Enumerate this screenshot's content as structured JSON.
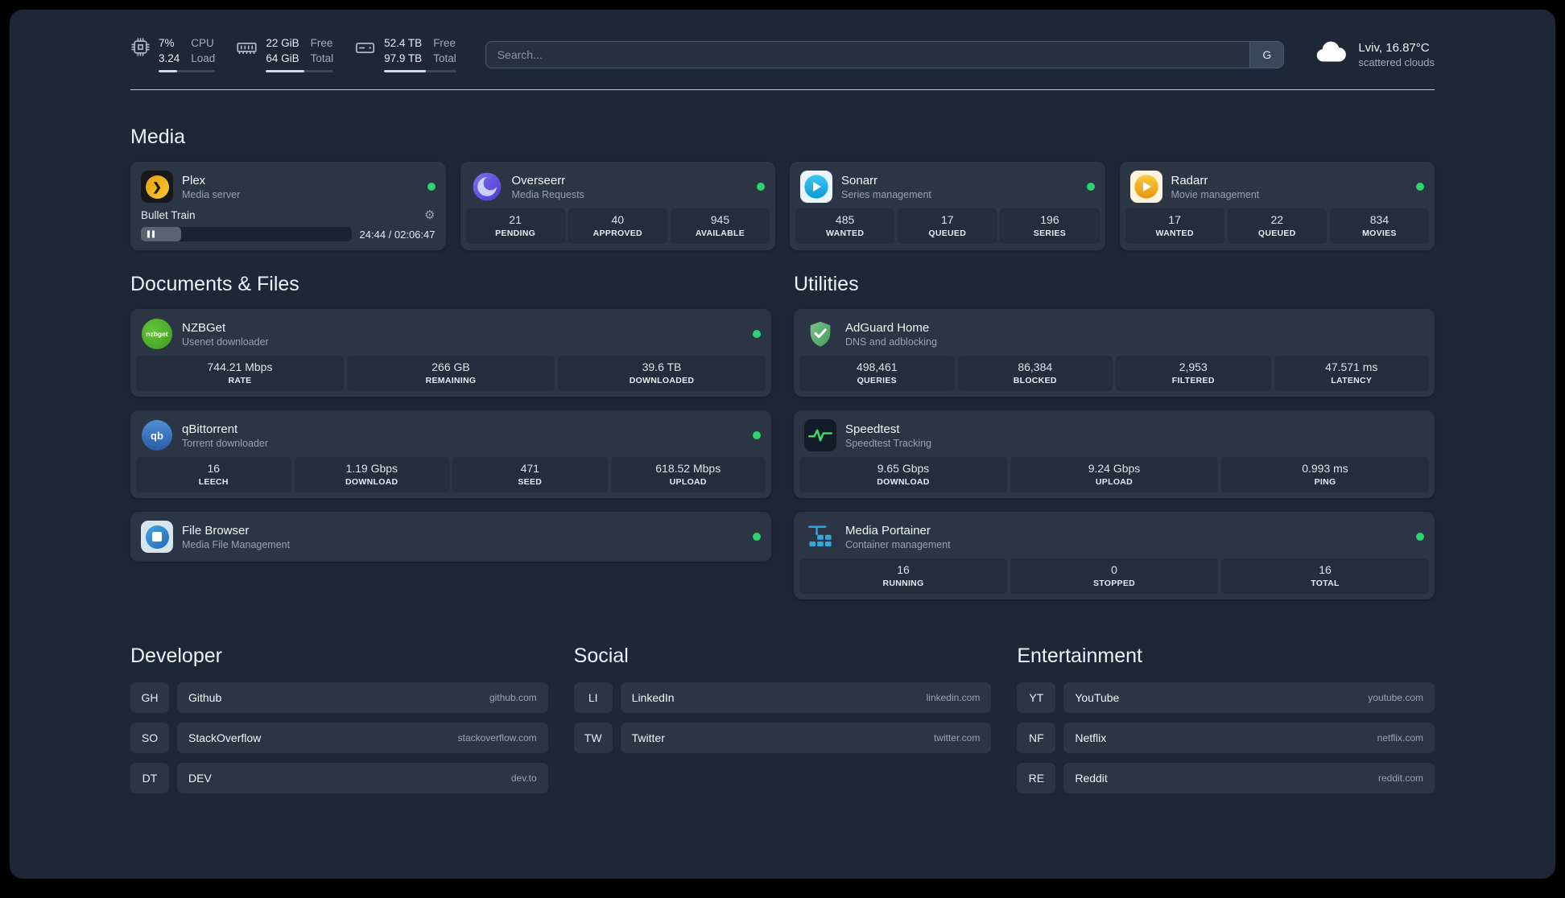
{
  "topbar": {
    "cpu": {
      "percent": "7%",
      "load": "3.24",
      "label_top": "CPU",
      "label_bottom": "Load",
      "progress": 33
    },
    "memory": {
      "free": "22 GiB",
      "total": "64 GiB",
      "label_top": "Free",
      "label_bottom": "Total",
      "progress": 57
    },
    "disk": {
      "free": "52.4 TB",
      "total": "97.9 TB",
      "label_top": "Free",
      "label_bottom": "Total",
      "progress": 58
    },
    "search": {
      "placeholder": "Search...",
      "provider": "G"
    },
    "weather": {
      "location": "Lviv, 16.87°C",
      "condition": "scattered clouds"
    }
  },
  "media": {
    "title": "Media",
    "plex": {
      "name": "Plex",
      "desc": "Media server",
      "stream_title": "Bullet Train",
      "stream_time": "24:44 / 02:06:47",
      "stream_progress": 19
    },
    "overseerr": {
      "name": "Overseerr",
      "desc": "Media Requests",
      "stats": [
        {
          "value": "21",
          "label": "PENDING"
        },
        {
          "value": "40",
          "label": "APPROVED"
        },
        {
          "value": "945",
          "label": "AVAILABLE"
        }
      ]
    },
    "sonarr": {
      "name": "Sonarr",
      "desc": "Series management",
      "stats": [
        {
          "value": "485",
          "label": "WANTED"
        },
        {
          "value": "17",
          "label": "QUEUED"
        },
        {
          "value": "196",
          "label": "SERIES"
        }
      ]
    },
    "radarr": {
      "name": "Radarr",
      "desc": "Movie management",
      "stats": [
        {
          "value": "17",
          "label": "WANTED"
        },
        {
          "value": "22",
          "label": "QUEUED"
        },
        {
          "value": "834",
          "label": "MOVIES"
        }
      ]
    }
  },
  "documents": {
    "title": "Documents & Files",
    "nzbget": {
      "name": "NZBGet",
      "desc": "Usenet downloader",
      "stats": [
        {
          "value": "744.21 Mbps",
          "label": "RATE"
        },
        {
          "value": "266 GB",
          "label": "REMAINING"
        },
        {
          "value": "39.6 TB",
          "label": "DOWNLOADED"
        }
      ]
    },
    "qbittorrent": {
      "name": "qBittorrent",
      "desc": "Torrent downloader",
      "stats": [
        {
          "value": "16",
          "label": "LEECH"
        },
        {
          "value": "1.19 Gbps",
          "label": "DOWNLOAD"
        },
        {
          "value": "471",
          "label": "SEED"
        },
        {
          "value": "618.52 Mbps",
          "label": "UPLOAD"
        }
      ]
    },
    "filebrowser": {
      "name": "File Browser",
      "desc": "Media File Management"
    }
  },
  "utilities": {
    "title": "Utilities",
    "adguard": {
      "name": "AdGuard Home",
      "desc": "DNS and adblocking",
      "stats": [
        {
          "value": "498,461",
          "label": "QUERIES"
        },
        {
          "value": "86,384",
          "label": "BLOCKED"
        },
        {
          "value": "2,953",
          "label": "FILTERED"
        },
        {
          "value": "47.571 ms",
          "label": "LATENCY"
        }
      ]
    },
    "speedtest": {
      "name": "Speedtest",
      "desc": "Speedtest Tracking",
      "stats": [
        {
          "value": "9.65 Gbps",
          "label": "DOWNLOAD"
        },
        {
          "value": "9.24 Gbps",
          "label": "UPLOAD"
        },
        {
          "value": "0.993 ms",
          "label": "PING"
        }
      ]
    },
    "portainer": {
      "name": "Media Portainer",
      "desc": "Container management",
      "stats": [
        {
          "value": "16",
          "label": "RUNNING"
        },
        {
          "value": "0",
          "label": "STOPPED"
        },
        {
          "value": "16",
          "label": "TOTAL"
        }
      ]
    }
  },
  "bookmarks": {
    "developer": {
      "title": "Developer",
      "items": [
        {
          "abbr": "GH",
          "name": "Github",
          "domain": "github.com"
        },
        {
          "abbr": "SO",
          "name": "StackOverflow",
          "domain": "stackoverflow.com"
        },
        {
          "abbr": "DT",
          "name": "DEV",
          "domain": "dev.to"
        }
      ]
    },
    "social": {
      "title": "Social",
      "items": [
        {
          "abbr": "LI",
          "name": "LinkedIn",
          "domain": "linkedin.com"
        },
        {
          "abbr": "TW",
          "name": "Twitter",
          "domain": "twitter.com"
        }
      ]
    },
    "entertainment": {
      "title": "Entertainment",
      "items": [
        {
          "abbr": "YT",
          "name": "YouTube",
          "domain": "youtube.com"
        },
        {
          "abbr": "NF",
          "name": "Netflix",
          "domain": "netflix.com"
        },
        {
          "abbr": "RE",
          "name": "Reddit",
          "domain": "reddit.com"
        }
      ]
    }
  },
  "icons": {
    "gear": "⚙",
    "plex_chevron": "❯",
    "nzbget_label": "nzbget",
    "qbittorrent_label": "qb"
  },
  "colors": {
    "background": "#1d2736",
    "card": "#2b3544",
    "stat_tile": "#232d3c",
    "status_online": "#2dd36f",
    "plex_orange": "#e9a60d",
    "overseerr_purple": "#6a5cd5",
    "sonarr_blue": "#35c5f4",
    "radarr_yellow": "#f4c63d",
    "nzbget_green": "#4fae2c",
    "qbittorrent_blue": "#3d76c2",
    "filebrowser_blue": "#2d7fd3",
    "adguard_green": "#67b279",
    "speedtest_green": "#42d96b",
    "portainer_blue": "#2fa8e1"
  }
}
